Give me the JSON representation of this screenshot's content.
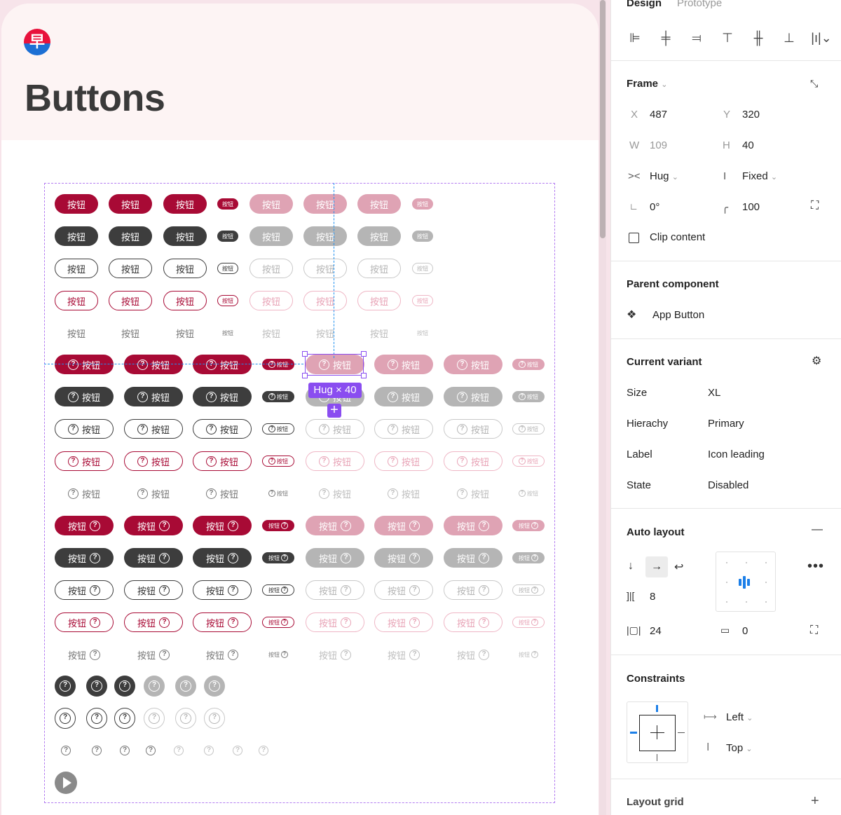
{
  "canvas": {
    "logo_char": "早",
    "page_title": "Buttons",
    "button_label": "按钮",
    "help_glyph": "?",
    "hug_badge": "Hug × 40",
    "hug_plus": "+"
  },
  "panel": {
    "tabs": [
      "Design",
      "Prototype"
    ],
    "frame": {
      "title": "Frame",
      "x_label": "X",
      "x_value": "487",
      "y_label": "Y",
      "y_value": "320",
      "w_label": "W",
      "w_value": "109",
      "h_label": "H",
      "h_value": "40",
      "width_mode": "Hug",
      "height_mode": "Fixed",
      "rotation": "0°",
      "radius": "100",
      "clip_content": "Clip content"
    },
    "parent_component": {
      "title": "Parent component",
      "name": "App Button"
    },
    "current_variant": {
      "title": "Current variant",
      "rows": [
        {
          "label": "Size",
          "value": "XL"
        },
        {
          "label": "Hierachy",
          "value": "Primary"
        },
        {
          "label": "Label",
          "value": "Icon leading"
        },
        {
          "label": "State",
          "value": "Disabled"
        }
      ]
    },
    "auto_layout": {
      "title": "Auto layout",
      "gap": "8",
      "padding_h": "24",
      "padding_v": "0"
    },
    "constraints": {
      "title": "Constraints",
      "horizontal": "Left",
      "vertical": "Top"
    },
    "layout_grid": {
      "title": "Layout grid"
    }
  },
  "colors": {
    "primary": "#a80a35",
    "dark": "#3d3d3d",
    "selection": "#8a4df0",
    "guide": "#1c8ff0"
  }
}
